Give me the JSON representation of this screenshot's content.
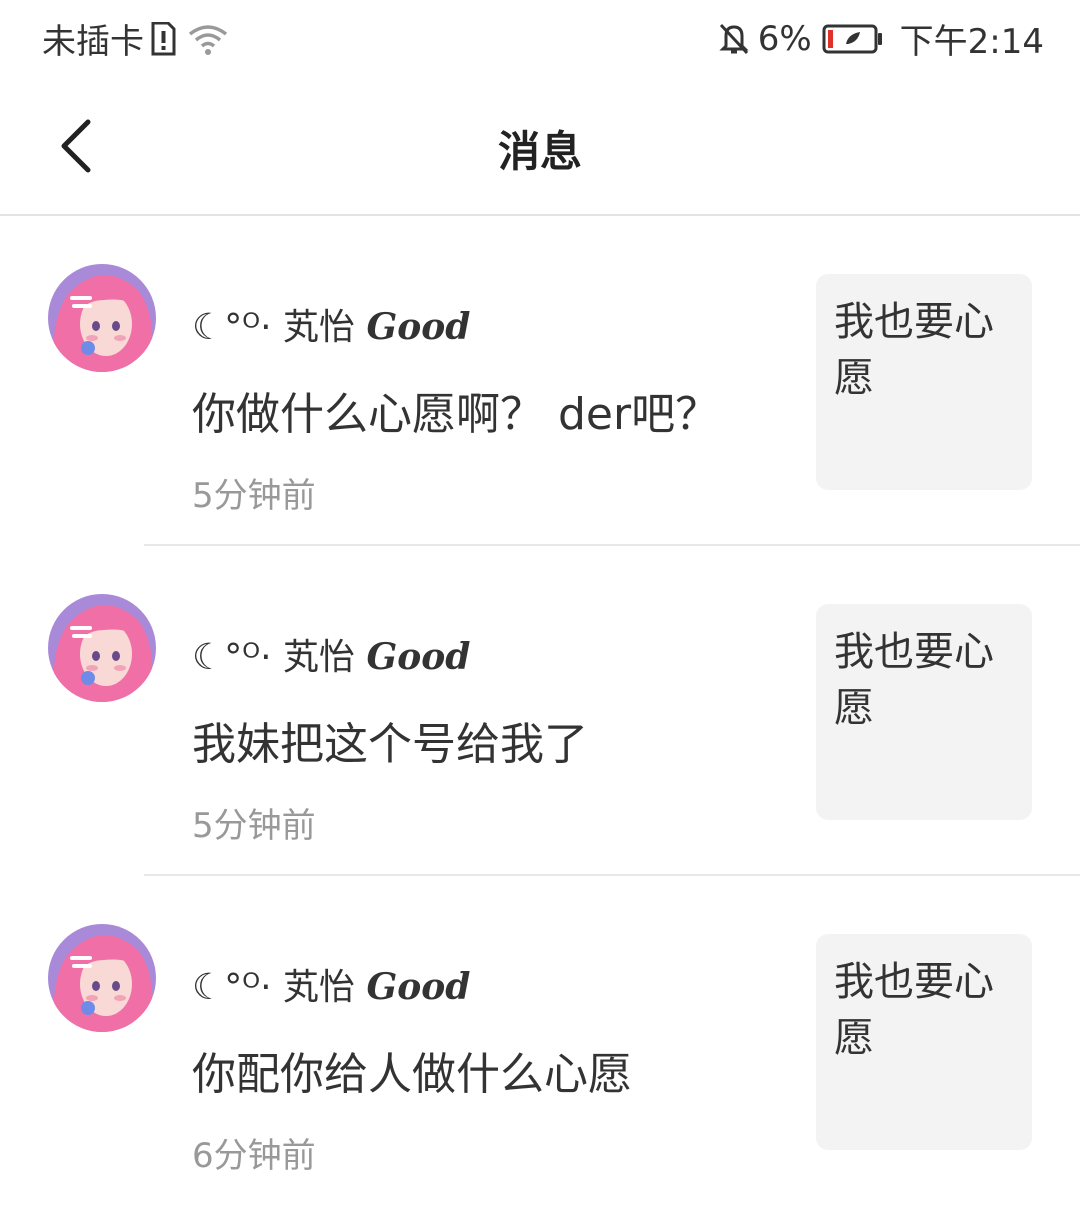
{
  "status_bar": {
    "carrier": "未插卡",
    "battery_percent": "6%",
    "time": "下午2:14",
    "colors": {
      "battery_low": "#e0302a"
    }
  },
  "header": {
    "title": "消息"
  },
  "messages": [
    {
      "username_prefix": "☾°ᴼ· 芄怡",
      "username_suffix": "Good",
      "text": "你做什么心愿啊？ der吧？",
      "time": "5分钟前",
      "wish_card": "我也要心愿"
    },
    {
      "username_prefix": "☾°ᴼ· 芄怡",
      "username_suffix": "Good",
      "text": "我妹把这个号给我了",
      "time": "5分钟前",
      "wish_card": "我也要心愿"
    },
    {
      "username_prefix": "☾°ᴼ· 芄怡",
      "username_suffix": "Good",
      "text": "你配你给人做什么心愿",
      "time": "6分钟前",
      "wish_card": "我也要心愿"
    }
  ]
}
